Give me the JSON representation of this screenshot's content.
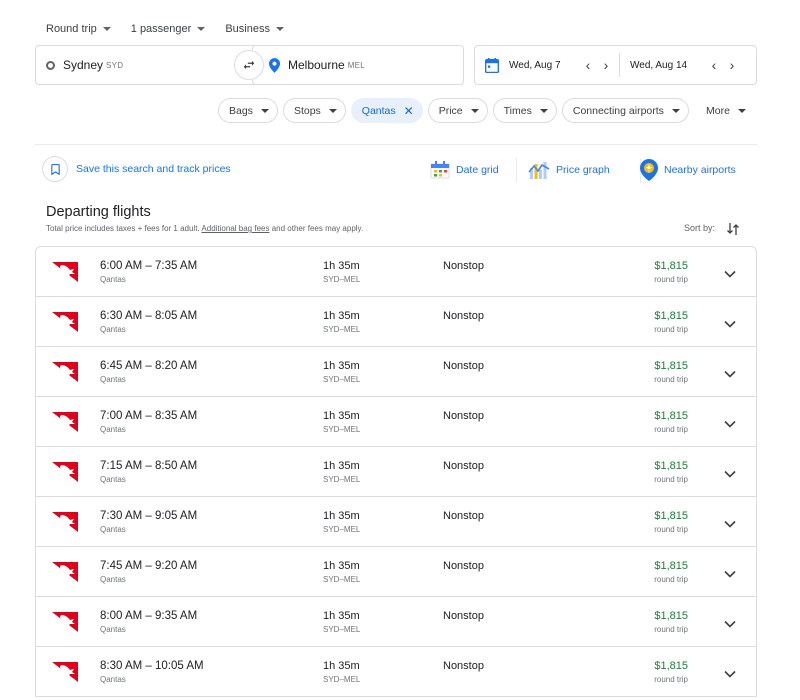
{
  "top": {
    "trip_type": "Round trip",
    "passengers": "1 passenger",
    "cabin": "Business"
  },
  "search": {
    "origin_city": "Sydney",
    "origin_code": "SYD",
    "dest_city": "Melbourne",
    "dest_code": "MEL",
    "depart_date": "Wed, Aug 7",
    "return_date": "Wed, Aug 14"
  },
  "filters": {
    "chips": [
      "Bags",
      "Stops",
      "Qantas",
      "Price",
      "Times",
      "Connecting airports"
    ],
    "active_chip": "Qantas",
    "more": "More"
  },
  "actions": {
    "track": "Save this search and track prices",
    "date_grid": "Date grid",
    "price_graph": "Price graph",
    "nearby": "Nearby airports"
  },
  "section": {
    "title": "Departing flights",
    "note_before": "Total price includes taxes + fees for 1 adult. ",
    "note_link": "Additional bag fees",
    "note_after": " and other fees may apply.",
    "sort_label": "Sort by:"
  },
  "colors": {
    "accent": "#1a73e8",
    "price": "#188038",
    "qantas_red": "#e0001b"
  },
  "flights": [
    {
      "times": "6:00 AM – 7:35 AM",
      "airline": "Qantas",
      "duration": "1h 35m",
      "route": "SYD–MEL",
      "stops": "Nonstop",
      "price": "$1,815",
      "price_type": "round trip"
    },
    {
      "times": "6:30 AM – 8:05 AM",
      "airline": "Qantas",
      "duration": "1h 35m",
      "route": "SYD–MEL",
      "stops": "Nonstop",
      "price": "$1,815",
      "price_type": "round trip"
    },
    {
      "times": "6:45 AM – 8:20 AM",
      "airline": "Qantas",
      "duration": "1h 35m",
      "route": "SYD–MEL",
      "stops": "Nonstop",
      "price": "$1,815",
      "price_type": "round trip"
    },
    {
      "times": "7:00 AM – 8:35 AM",
      "airline": "Qantas",
      "duration": "1h 35m",
      "route": "SYD–MEL",
      "stops": "Nonstop",
      "price": "$1,815",
      "price_type": "round trip"
    },
    {
      "times": "7:15 AM – 8:50 AM",
      "airline": "Qantas",
      "duration": "1h 35m",
      "route": "SYD–MEL",
      "stops": "Nonstop",
      "price": "$1,815",
      "price_type": "round trip"
    },
    {
      "times": "7:30 AM – 9:05 AM",
      "airline": "Qantas",
      "duration": "1h 35m",
      "route": "SYD–MEL",
      "stops": "Nonstop",
      "price": "$1,815",
      "price_type": "round trip"
    },
    {
      "times": "7:45 AM – 9:20 AM",
      "airline": "Qantas",
      "duration": "1h 35m",
      "route": "SYD–MEL",
      "stops": "Nonstop",
      "price": "$1,815",
      "price_type": "round trip"
    },
    {
      "times": "8:00 AM – 9:35 AM",
      "airline": "Qantas",
      "duration": "1h 35m",
      "route": "SYD–MEL",
      "stops": "Nonstop",
      "price": "$1,815",
      "price_type": "round trip"
    },
    {
      "times": "8:30 AM – 10:05 AM",
      "airline": "Qantas",
      "duration": "1h 35m",
      "route": "SYD–MEL",
      "stops": "Nonstop",
      "price": "$1,815",
      "price_type": "round trip"
    }
  ]
}
